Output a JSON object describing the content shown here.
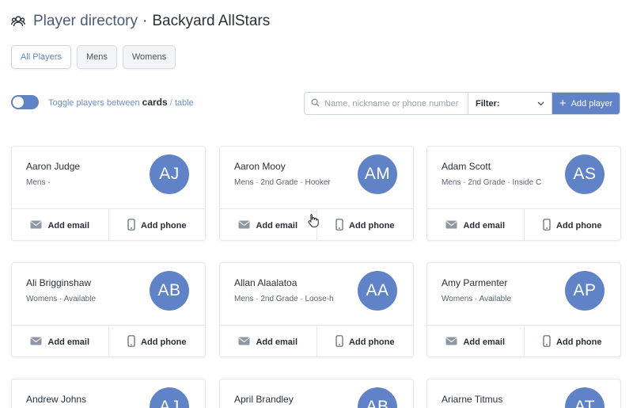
{
  "header": {
    "title": "Player directory",
    "separator": "·",
    "team": "Backyard AllStars",
    "icon": "people-icon"
  },
  "tabs": [
    {
      "label": "All Players",
      "active": true
    },
    {
      "label": "Mens",
      "active": false
    },
    {
      "label": "Womens",
      "active": false
    }
  ],
  "view_toggle": {
    "prefix": "Toggle players between ",
    "option_cards": "cards",
    "slash": " / ",
    "option_table": "table",
    "on": true
  },
  "toolbar": {
    "search_placeholder": "Name, nickname or phone number",
    "filter_label": "Filter:",
    "add_label": "Add player"
  },
  "card_actions": {
    "email": "Add email",
    "phone": "Add phone"
  },
  "players": [
    {
      "name": "Aaron Judge",
      "meta": "Mens  ·",
      "initials": "AJ"
    },
    {
      "name": "Aaron Mooy",
      "meta": "Mens  ·  2nd Grade · Hooker",
      "initials": "AM"
    },
    {
      "name": "Adam Scott",
      "meta": "Mens  ·  2nd Grade · Inside C",
      "initials": "AS"
    },
    {
      "name": "Ali Brigginshaw",
      "meta": "Womens  ·  Available",
      "initials": "AB"
    },
    {
      "name": "Allan Alaalatoa",
      "meta": "Mens  ·  2nd Grade · Loose-h",
      "initials": "AA"
    },
    {
      "name": "Amy Parmenter",
      "meta": "Womens  ·  Available",
      "initials": "AP"
    },
    {
      "name": "Andrew Johns",
      "meta": "",
      "initials": "AJ"
    },
    {
      "name": "April Brandley",
      "meta": "",
      "initials": "AB"
    },
    {
      "name": "Ariarne Titmus",
      "meta": "",
      "initials": "AT"
    }
  ],
  "colors": {
    "accent": "#5f83c6",
    "text": "#2b2f38",
    "border": "#e6e8ec"
  }
}
